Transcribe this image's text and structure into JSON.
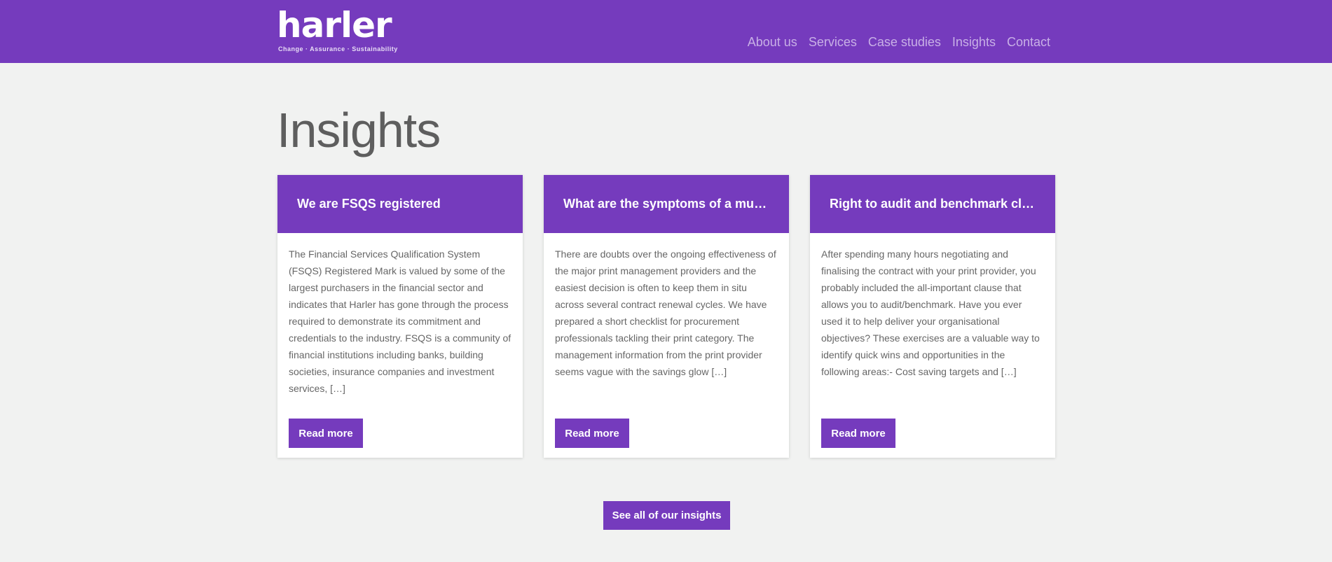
{
  "header": {
    "logo_text": "harler",
    "logo_tagline": "Change · Assurance · Sustainability",
    "nav": [
      "About us",
      "Services",
      "Case studies",
      "Insights",
      "Contact"
    ]
  },
  "page": {
    "title": "Insights"
  },
  "cards": [
    {
      "title": "We are FSQS registered",
      "excerpt": "The Financial Services Qualification System (FSQS) Registered Mark is valued by some of the largest purchasers in the financial sector and indicates that Harler has gone through the process required to demonstrate its commitment and credentials to the industry. FSQS is a community of financial institutions including banks, building societies, insurance companies and investment services, […]",
      "button": "Read more"
    },
    {
      "title": "What are the symptoms of a mul…",
      "excerpt": "There are doubts over the ongoing effectiveness of the major print management providers and the easiest decision is often to keep them in situ across several contract renewal cycles. We have prepared a short checklist for procurement professionals tackling their print category. The management information from the print provider seems vague with the savings glow […]",
      "button": "Read more"
    },
    {
      "title": "Right to audit and benchmark cl…",
      "excerpt": "After spending many hours negotiating and finalising the contract with your print provider, you probably included the all-important clause that allows you to audit/benchmark. Have you ever used it to help deliver your organisational objectives? These exercises are a valuable way to identify quick wins and opportunities in the following areas:- Cost saving targets and […]",
      "button": "Read more"
    }
  ],
  "cta": {
    "label": "See all of our insights"
  },
  "colors": {
    "brand": "#753bbd",
    "background": "#f1f2f1",
    "nav_text": "#c8b0e6"
  }
}
